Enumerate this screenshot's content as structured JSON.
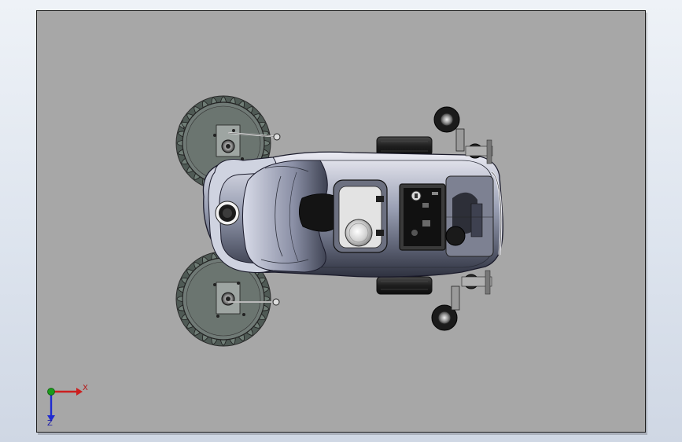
{
  "viewport": {
    "background": "#a7a7a7",
    "frame_border": "#202020",
    "model": "top-view-vehicle-assembly"
  },
  "triad": {
    "x_label": "X",
    "y_label": "Z",
    "x_color": "#cc1f1f",
    "y_color": "#1f2bd1",
    "origin_color": "#1a9b1a"
  }
}
